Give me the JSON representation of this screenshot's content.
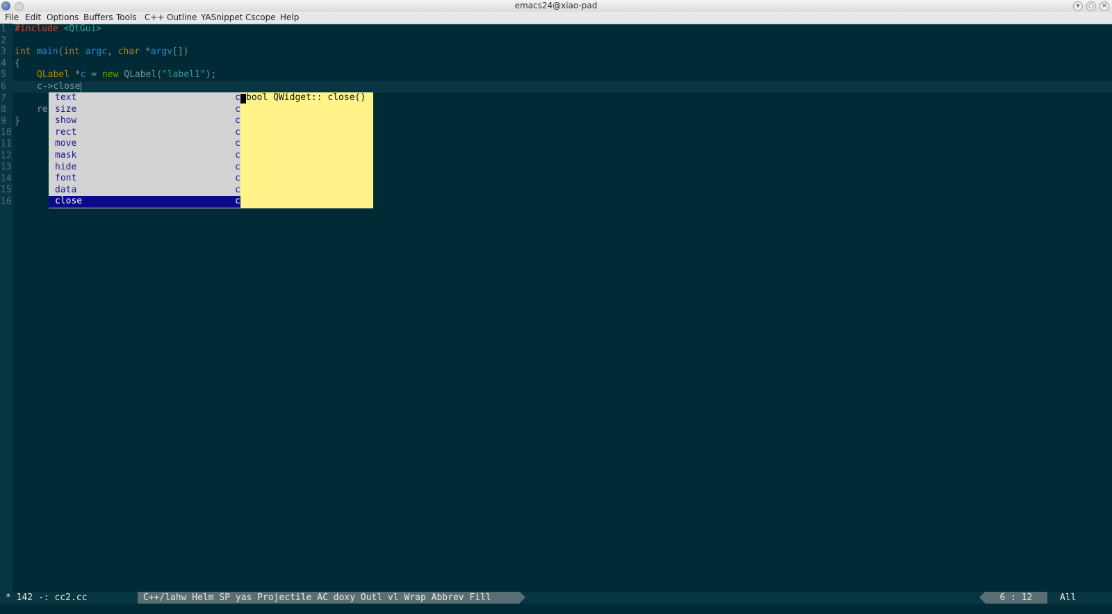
{
  "window": {
    "title": "emacs24@xiao-pad"
  },
  "menu": [
    "File",
    "Edit",
    "Options",
    "Buffers",
    "Tools",
    "C++",
    "Outline",
    "YASnippet",
    "Cscope",
    "Help"
  ],
  "line_numbers": [
    "1",
    "2",
    "3",
    "4",
    "5",
    "6",
    "7",
    "8",
    "9",
    "10",
    "11",
    "12",
    "13",
    "14",
    "15",
    "16"
  ],
  "code": {
    "l1_pre": "#include",
    "l1_hdr": "<QtGui>",
    "l3_int": "int",
    "l3_main": "main",
    "l3_p1": "(",
    "l3_int2": "int",
    "l3_argc": "argc",
    "l3_p2": ", ",
    "l3_char": "char",
    "l3_star": " *",
    "l3_argv": "argv",
    "l3_p3": "[])",
    "l4": "{",
    "l5_type": "QLabel",
    "l5_star": " *",
    "l5_var": "c",
    "l5_eq": " = ",
    "l5_new": "new",
    "l5_ctor": " QLabel(",
    "l5_str": "\"label1\"",
    "l5_end": ");",
    "l6_text": "c->close",
    "l8_text": "re",
    "l9": "}"
  },
  "completion": {
    "items": [
      "text",
      "size",
      "show",
      "rect",
      "move",
      "mask",
      "hide",
      "font",
      "data",
      "close"
    ],
    "symbol": "c",
    "selected": "close",
    "quick_help": "bool QWidget:: close()"
  },
  "modeline": {
    "left": "* 142 -: cc2.cc",
    "modes": " C++/lahw Helm SP yas Projectile AC doxy Outl vl Wrap Abbrev Fill ",
    "position": "6 : 12",
    "extent": "All"
  }
}
